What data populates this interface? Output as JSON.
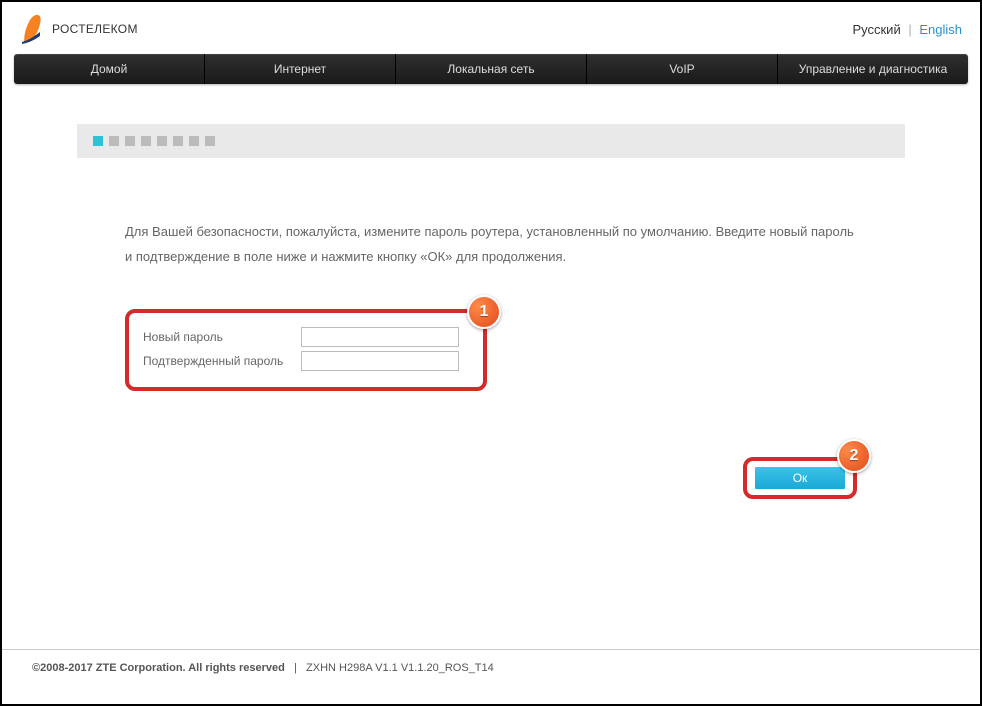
{
  "brand": "РОСТЕЛЕКОМ",
  "language": {
    "russian": "Русский",
    "english": "English"
  },
  "nav": [
    "Домой",
    "Интернет",
    "Локальная сеть",
    "VoIP",
    "Управление и диагностика"
  ],
  "wizard": {
    "steps": 8,
    "active": 0
  },
  "instructions": "Для Вашей безопасности, пожалуйста, измените пароль роутера, установленный по умолчанию. Введите новый пароль и подтверждение в поле ниже и нажмите кнопку «ОК» для продолжения.",
  "form": {
    "new_password_label": "Новый пароль",
    "confirm_password_label": "Подтвержденный пароль",
    "new_password_value": "",
    "confirm_password_value": ""
  },
  "buttons": {
    "ok": "Ок"
  },
  "annotations": {
    "badge1": "1",
    "badge2": "2"
  },
  "footer": {
    "copyright": "©2008-2017 ZTE Corporation. All rights reserved",
    "model": "ZXHN H298A V1.1 V1.1.20_ROS_T14"
  }
}
